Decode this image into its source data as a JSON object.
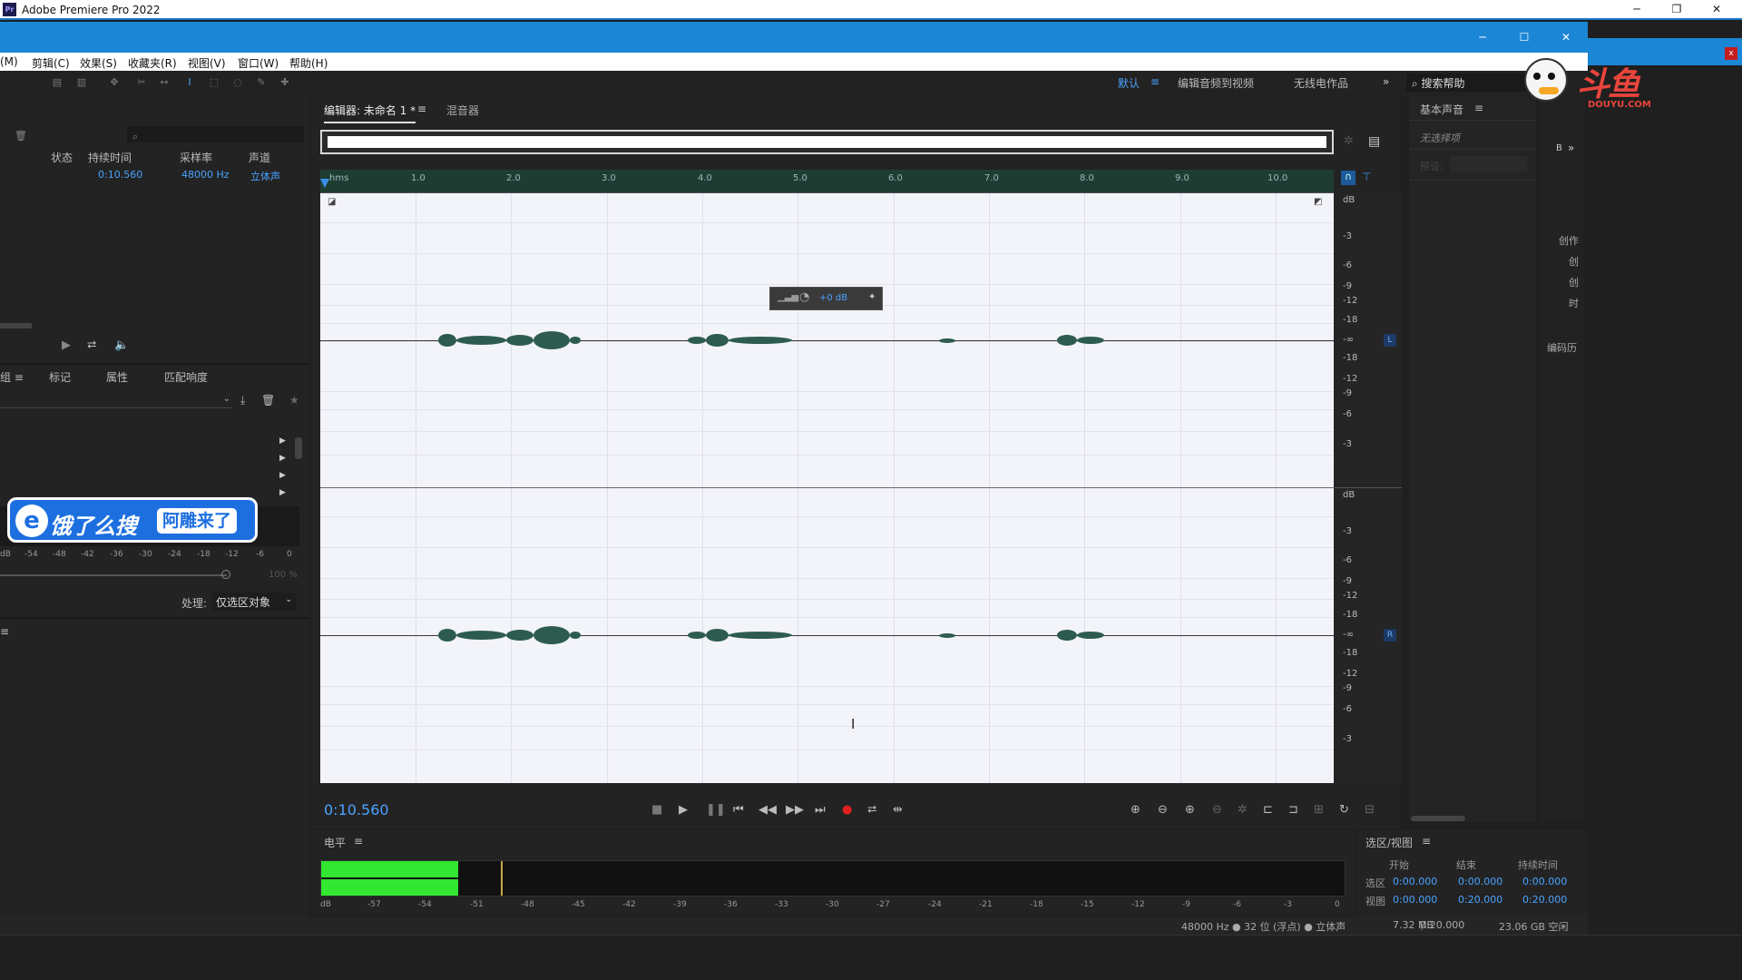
{
  "window": {
    "title": "Adobe Premiere Pro 2022"
  },
  "menu": [
    "(M)",
    "剪辑(C)",
    "效果(S)",
    "收藏夹(R)",
    "视图(V)",
    "窗口(W)",
    "帮助(H)"
  ],
  "workspaces": {
    "default": "默认",
    "edit_audio": "编辑音频到视频",
    "wireless": "无线电作品",
    "search_placeholder": "搜索帮助"
  },
  "files_panel": {
    "columns": [
      "状态",
      "持续时间",
      "采样率",
      "声道"
    ],
    "row": {
      "duration": "0:10.560",
      "sample_rate": "48000 Hz",
      "channel": "立体声"
    }
  },
  "effects_panel": {
    "tabs": [
      "组",
      "标记",
      "属性",
      "匹配响度"
    ],
    "scale": [
      "dB",
      "-54",
      "-48",
      "-42",
      "-36",
      "-30",
      "-24",
      "-18",
      "-12",
      "-6",
      "0"
    ],
    "mix_pct": "100 %",
    "process_label": "处理:",
    "process_value": "仅选区对象"
  },
  "editor": {
    "tab_editor": "编辑器: 未命名 1 *",
    "tab_mixer": "混音器",
    "ruler_unit": "hms",
    "ruler_ticks": [
      "1.0",
      "2.0",
      "3.0",
      "4.0",
      "5.0",
      "6.0",
      "7.0",
      "8.0",
      "9.0",
      "10.0"
    ],
    "db_scale_top": [
      "dB",
      "-3",
      "-6",
      "-9",
      "-12",
      "-18",
      "-∞",
      "-18",
      "-12",
      "-9",
      "-6",
      "-3"
    ],
    "db_scale_bottom": [
      "dB",
      "-3",
      "-6",
      "-9",
      "-12",
      "-18",
      "-∞",
      "-18",
      "-12",
      "-9",
      "-6",
      "-3"
    ],
    "channel_left": "L",
    "channel_right": "R",
    "hud_gain": "+0 dB",
    "current_time": "0:10.560"
  },
  "levels": {
    "title": "电平",
    "scale": [
      "dB",
      "-57",
      "-54",
      "-51",
      "-48",
      "-45",
      "-42",
      "-39",
      "-36",
      "-33",
      "-30",
      "-27",
      "-24",
      "-21",
      "-18",
      "-15",
      "-12",
      "-9",
      "-6",
      "-3",
      "0"
    ],
    "meter_fill_fraction": 0.134
  },
  "selection_view": {
    "title": "选区/视图",
    "headers": [
      "开始",
      "结束",
      "持续时间"
    ],
    "selection_label": "选区",
    "view_label": "视图",
    "selection": [
      "0:00.000",
      "0:00.000",
      "0:00.000"
    ],
    "view": [
      "0:00.000",
      "0:20.000",
      "0:20.000"
    ]
  },
  "essential_sound": {
    "title": "基本声音",
    "none_selected": "无选择项",
    "preset": "预设:"
  },
  "far_right": [
    "创作",
    "创",
    "创",
    "时",
    "编码历"
  ],
  "status": {
    "format": "48000 Hz ● 32 位 (浮点) ● 立体声",
    "size": "7.32 MB",
    "duration": "0:20.000",
    "free": "23.06 GB 空闲"
  },
  "ad_banner": {
    "left": "饿了么搜",
    "right": "阿雕来了"
  },
  "watermark": {
    "brand": "斗鱼",
    "url": "DOUYU.COM"
  },
  "colors": {
    "accent": "#1c86d6",
    "waveform": "#2d5c4e",
    "meter": "#32e632"
  }
}
